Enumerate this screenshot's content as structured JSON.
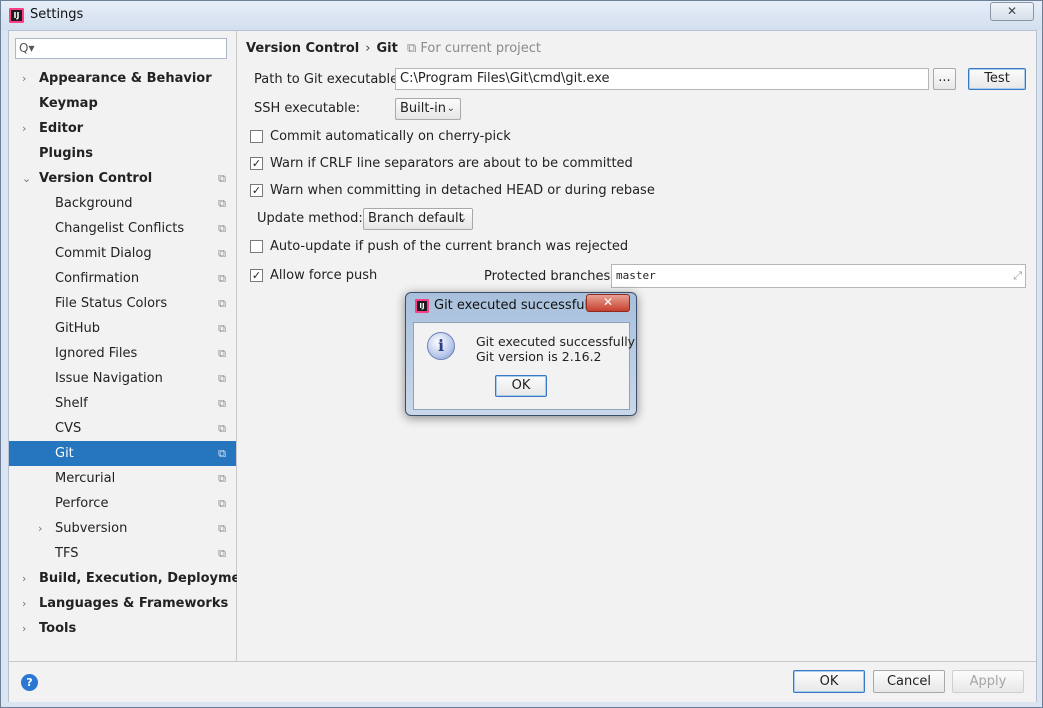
{
  "window": {
    "title": "Settings",
    "close_glyph": "✕"
  },
  "sidebar": {
    "search_placeholder": "",
    "search_icon": "Q▾",
    "items": [
      {
        "label": "Appearance & Behavior",
        "level": 0,
        "arrow": "›",
        "bold": true
      },
      {
        "label": "Keymap",
        "level": 0,
        "arrow": "",
        "bold": true
      },
      {
        "label": "Editor",
        "level": 0,
        "arrow": "›",
        "bold": true
      },
      {
        "label": "Plugins",
        "level": 0,
        "arrow": "",
        "bold": true
      },
      {
        "label": "Version Control",
        "level": 0,
        "arrow": "⌄",
        "bold": true,
        "proj": true
      },
      {
        "label": "Background",
        "level": 1,
        "proj": true
      },
      {
        "label": "Changelist Conflicts",
        "level": 1,
        "proj": true
      },
      {
        "label": "Commit Dialog",
        "level": 1,
        "proj": true
      },
      {
        "label": "Confirmation",
        "level": 1,
        "proj": true
      },
      {
        "label": "File Status Colors",
        "level": 1,
        "proj": true
      },
      {
        "label": "GitHub",
        "level": 1,
        "proj": true
      },
      {
        "label": "Ignored Files",
        "level": 1,
        "proj": true
      },
      {
        "label": "Issue Navigation",
        "level": 1,
        "proj": true
      },
      {
        "label": "Shelf",
        "level": 1,
        "proj": true
      },
      {
        "label": "CVS",
        "level": 1,
        "proj": true
      },
      {
        "label": "Git",
        "level": 1,
        "proj": true,
        "selected": true
      },
      {
        "label": "Mercurial",
        "level": 1,
        "proj": true
      },
      {
        "label": "Perforce",
        "level": 1,
        "proj": true
      },
      {
        "label": "Subversion",
        "level": 1,
        "arrow": "›",
        "proj": true
      },
      {
        "label": "TFS",
        "level": 1,
        "proj": true
      },
      {
        "label": "Build, Execution, Deployment",
        "level": 0,
        "arrow": "›",
        "bold": true
      },
      {
        "label": "Languages & Frameworks",
        "level": 0,
        "arrow": "›",
        "bold": true
      },
      {
        "label": "Tools",
        "level": 0,
        "arrow": "›",
        "bold": true
      }
    ],
    "project_icon_glyph": "⧉"
  },
  "breadcrumb": {
    "parent": "Version Control",
    "separator": "›",
    "current": "Git",
    "note": "⧉ For current project"
  },
  "git": {
    "path_label": "Path to Git executable:",
    "path_value": "C:\\Program Files\\Git\\cmd\\git.exe",
    "browse_label": "...",
    "test_label": "Test",
    "ssh_label": "SSH executable:",
    "ssh_value": "Built-in",
    "checkboxes": [
      {
        "label": "Commit automatically on cherry-pick",
        "checked": false
      },
      {
        "label": "Warn if CRLF line separators are about to be committed",
        "checked": true
      },
      {
        "label": "Warn when committing in detached HEAD or during rebase",
        "checked": true
      }
    ],
    "update_method_label": "Update method:",
    "update_method_value": "Branch default",
    "auto_update_label": "Auto-update if push of the current branch was rejected",
    "auto_update_checked": false,
    "force_push_label": "Allow force push",
    "force_push_checked": true,
    "protected_label": "Protected branches:",
    "protected_value": "master",
    "check_glyph": "✓",
    "chevron_glyph": "⌄",
    "expand_glyph": "⤢"
  },
  "dialog": {
    "title": "Git executed successfully",
    "line1": "Git executed successfully",
    "line2": "Git version is 2.16.2",
    "ok_label": "OK",
    "close_glyph": "✕",
    "info_glyph": "i"
  },
  "footer": {
    "help_glyph": "?",
    "ok_label": "OK",
    "cancel_label": "Cancel",
    "apply_label": "Apply"
  }
}
